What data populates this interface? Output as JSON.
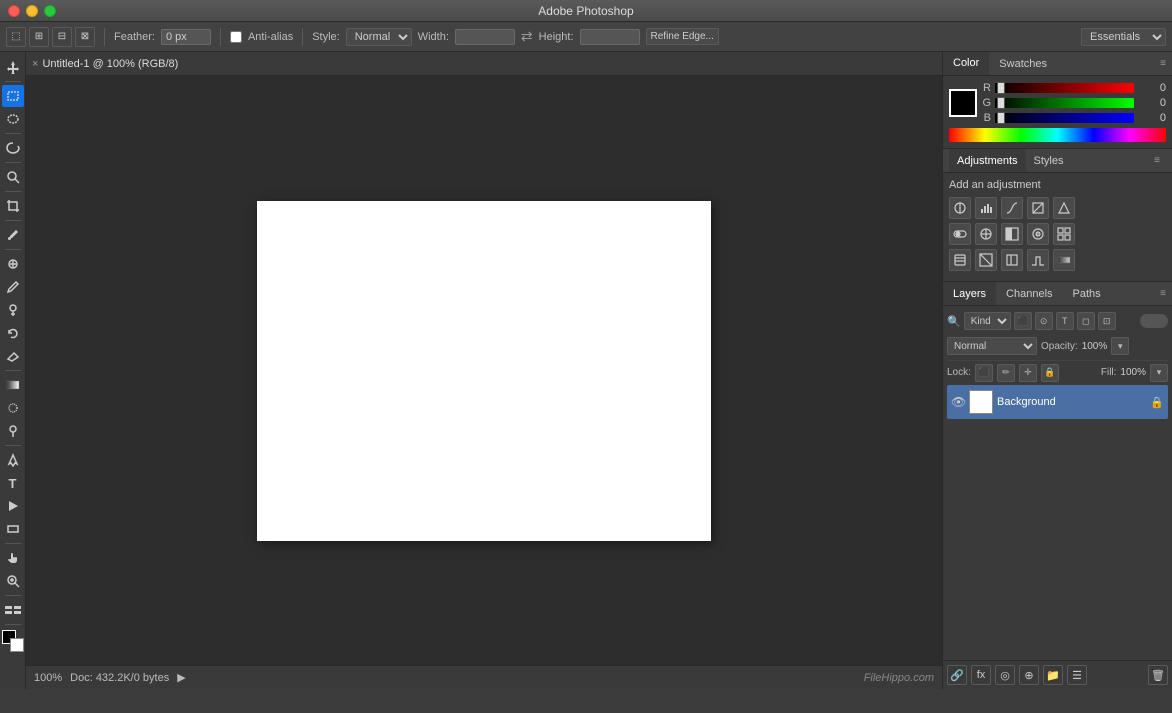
{
  "titlebar": {
    "title": "Adobe Photoshop"
  },
  "options_bar": {
    "feather_label": "Feather:",
    "feather_value": "0 px",
    "anti_alias_label": "Anti-alias",
    "style_label": "Style:",
    "style_value": "Normal",
    "width_label": "Width:",
    "height_label": "Height:",
    "refine_edge_btn": "Refine Edge...",
    "essentials_value": "Essentials"
  },
  "tab": {
    "close": "×",
    "title": "Untitled-1 @ 100% (RGB/8)"
  },
  "color_panel": {
    "tab_color": "Color",
    "tab_swatches": "Swatches",
    "r_label": "R",
    "g_label": "G",
    "b_label": "B",
    "r_value": "0",
    "g_value": "0",
    "b_value": "0"
  },
  "adjustments_panel": {
    "tab_adjustments": "Adjustments",
    "tab_styles": "Styles",
    "title": "Add an adjustment",
    "icons": [
      "☀",
      "▦",
      "◑",
      "▣",
      "▽",
      "⬛",
      "⚖",
      "▣",
      "⬜",
      "🔵",
      "▦",
      "◻",
      "◼",
      "◻",
      "▣",
      "⊡",
      "◧"
    ]
  },
  "layers_panel": {
    "tab_layers": "Layers",
    "tab_channels": "Channels",
    "tab_paths": "Paths",
    "search_placeholder": "🔍",
    "kind_label": "Kind",
    "blend_mode": "Normal",
    "opacity_label": "Opacity:",
    "opacity_value": "100%",
    "lock_label": "Lock:",
    "fill_label": "Fill:",
    "fill_value": "100%",
    "layer_name": "Background",
    "footer_btns": [
      "🔗",
      "fx",
      "◎",
      "☰",
      "📁",
      "🗑"
    ]
  },
  "status_bar": {
    "zoom": "100%",
    "doc_info": "Doc: 432.2K/0 bytes",
    "arrow": "▶"
  },
  "watermark": "FileHippo.com",
  "tools": [
    {
      "name": "move",
      "icon": "✛"
    },
    {
      "name": "marquee-rect",
      "icon": "⬚"
    },
    {
      "name": "marquee-ellipse",
      "icon": "◯"
    },
    {
      "name": "lasso",
      "icon": "⌇"
    },
    {
      "name": "quick-select",
      "icon": "✦"
    },
    {
      "name": "crop",
      "icon": "⊡"
    },
    {
      "name": "eyedropper",
      "icon": "⊘"
    },
    {
      "name": "healing",
      "icon": "⊕"
    },
    {
      "name": "brush",
      "icon": "✏"
    },
    {
      "name": "clone",
      "icon": "⊛"
    },
    {
      "name": "history",
      "icon": "◫"
    },
    {
      "name": "eraser",
      "icon": "◻"
    },
    {
      "name": "gradient",
      "icon": "◧"
    },
    {
      "name": "blur",
      "icon": "◉"
    },
    {
      "name": "dodge",
      "icon": "◑"
    },
    {
      "name": "pen",
      "icon": "✒"
    },
    {
      "name": "type",
      "icon": "T"
    },
    {
      "name": "path-select",
      "icon": "↖"
    },
    {
      "name": "shape",
      "icon": "▭"
    },
    {
      "name": "hand",
      "icon": "✋"
    },
    {
      "name": "zoom",
      "icon": "⊕"
    },
    {
      "name": "extras",
      "icon": "⇔"
    },
    {
      "name": "colors",
      "icon": "◼"
    }
  ]
}
